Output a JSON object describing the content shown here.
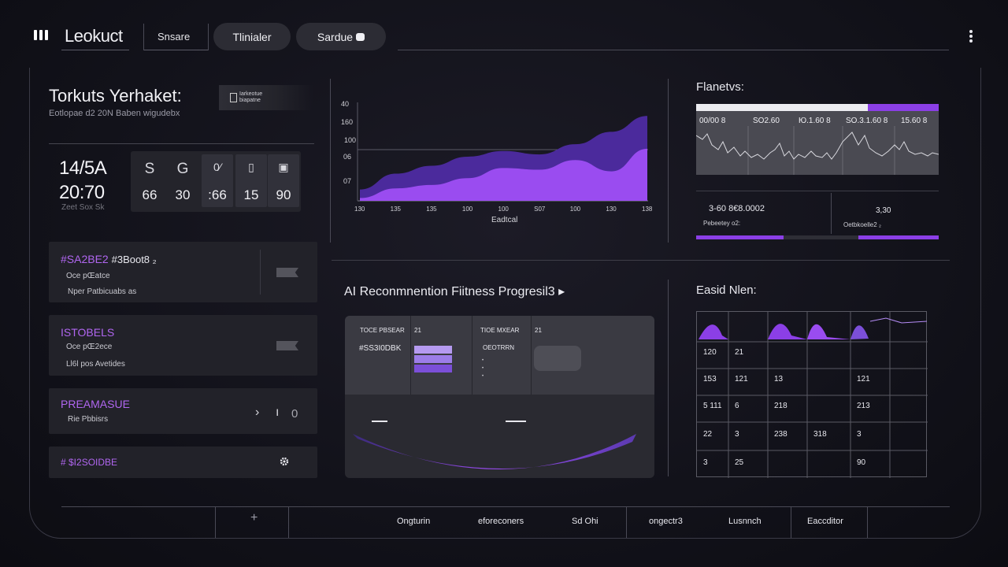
{
  "header": {
    "app_title": "Leokuct",
    "tab_plain": "Snsare",
    "pill_1": "Tlinialer",
    "pill_2": "Sardue"
  },
  "summary": {
    "title": "Torkuts Yerhaket:",
    "subtitle": "Eotlopae d2 20N Baben wigudebx",
    "thumb_text_1": "Iarkeotue",
    "thumb_text_2": "biapatne",
    "big_num_1": "14/5A",
    "big_num_2": "20:70",
    "small_label": "Zeet Sox Sk",
    "stats": [
      {
        "icon": "S",
        "value": "66"
      },
      {
        "icon": "G",
        "value": "30"
      },
      {
        "icon": "0⁄",
        "value": ":66"
      },
      {
        "icon": "▯",
        "value": "15"
      },
      {
        "icon": "▣",
        "value": "90"
      }
    ]
  },
  "cards": [
    {
      "title": "#SA2BE2",
      "title_extra": "#3Boot8 ₂",
      "line1": "Oce pŒatce",
      "line2": "Nper Patbicuabs as"
    },
    {
      "title": "ISTOBELS",
      "line1": "Oce pŒ2ece",
      "line2": "Ll6l pos Avetides"
    },
    {
      "title": "PREAMASUE",
      "line1": "Rie Pbbisrs",
      "ctrl_1": "›",
      "ctrl_2": "ı",
      "ctrl_3": "0"
    },
    {
      "title": "# $I2SOIDBE"
    }
  ],
  "main_chart": {
    "y_ticks": [
      "160",
      "100",
      "06",
      "07"
    ],
    "y_tick_top": "40",
    "x_ticks": [
      "130",
      "135",
      "135",
      "100",
      "100",
      "S07",
      "100",
      "130",
      "138"
    ],
    "x_title": "Eadtcal"
  },
  "chart_data": {
    "type": "area",
    "title": "",
    "xlabel": "Eadtcal",
    "ylabel": "",
    "x": [
      "130",
      "135",
      "135",
      "100",
      "100",
      "S07",
      "100",
      "130",
      "138"
    ],
    "series": [
      {
        "values": [
          20,
          48,
          62,
          78,
          88,
          82,
          100,
          122,
          150
        ]
      },
      {
        "values": [
          5,
          22,
          28,
          40,
          58,
          55,
          72,
          52,
          92
        ]
      }
    ],
    "colors": [
      "#4b2a9c",
      "#9a4cf0"
    ]
  },
  "right_top": {
    "title": "Flanetvs:",
    "graph_labels": [
      "00/00 8",
      "SO2.60",
      "Ю.1.60 8",
      "SO.3.1.60 8",
      "15.60 8"
    ],
    "value_1": "3‑60 8€8.0002",
    "value_2": "3,30",
    "small_1": "Pebeetey o2:",
    "small_2": "Oetbkoelle2 ₂",
    "progress_1": 0.36,
    "progress_2": 0.33
  },
  "recommend": {
    "title": "AI Reconmnention Fiitness Progresil3 ▸",
    "col1_head": "TOCE PBSEAR",
    "col1_num": "21",
    "col1_val": "#SS3I0DBK",
    "col2_head": "TIOE MXEAR",
    "col2_num": "21",
    "col2_val": "OEOTRRN"
  },
  "grid": {
    "title": "Easid Nlen:",
    "rows": [
      [
        "120",
        "21",
        "",
        "",
        "",
        ""
      ],
      [
        "153",
        "121",
        "13",
        "",
        "121",
        ""
      ],
      [
        "5 111",
        "6",
        "218",
        "",
        "213",
        ""
      ],
      [
        "22",
        "3",
        "238",
        "318",
        "3",
        ""
      ],
      [
        "3",
        "25",
        "",
        "",
        "90",
        ""
      ]
    ]
  },
  "bottom": {
    "plus": "+",
    "items": [
      "Ongturin",
      "eforeconers",
      "Sd Ohi",
      "ongectr3",
      "Lusnnch",
      "Eaccditor"
    ]
  },
  "colors": {
    "accent": "#9a4cf0",
    "accent_dark": "#4b2a9c",
    "panel": "#222229",
    "background": "#14141b"
  }
}
